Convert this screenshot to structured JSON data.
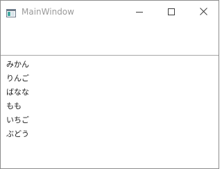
{
  "window": {
    "title": "MainWindow",
    "controls": {
      "minimize_icon": "minimize-icon",
      "maximize_icon": "maximize-icon",
      "close_icon": "close-icon"
    }
  },
  "list": {
    "items": [
      "みかん",
      "りんご",
      "ばなな",
      "もも",
      "いちご",
      "ぶどう"
    ]
  },
  "colors": {
    "title_text": "#9a9a9a",
    "border": "#8c8c8c",
    "list_text": "#1a1a1a"
  }
}
